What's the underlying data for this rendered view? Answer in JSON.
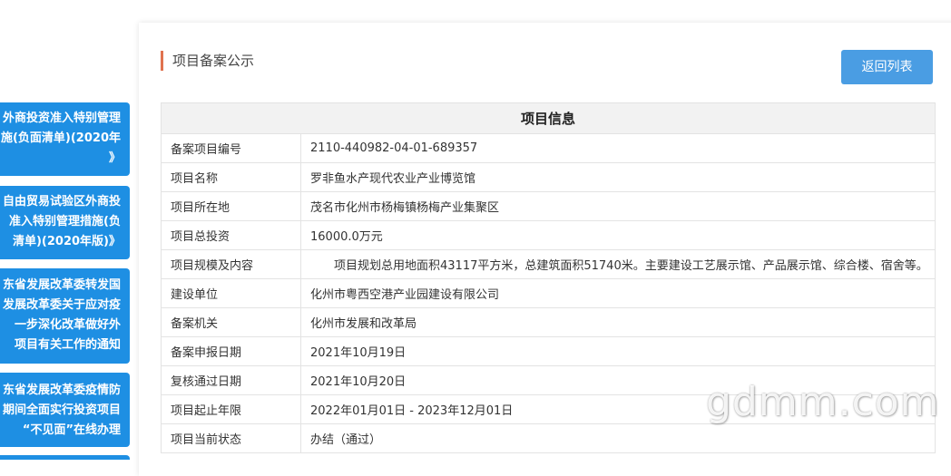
{
  "sidebar": {
    "cards": [
      {
        "lines": [
          "外商投资准入特别管理",
          "施(负面清单)(2020年",
          "》"
        ]
      },
      {
        "lines": [
          "自由贸易试验区外商投",
          "准入特别管理措施(负",
          "清单)(2020年版)》"
        ]
      },
      {
        "lines": [
          "东省发展改革委转发国",
          "发展改革委关于应对疫",
          "一步深化改革做好外",
          "项目有关工作的通知"
        ]
      },
      {
        "lines": [
          "东省发展改革委疫情防",
          "期间全面实行投资项目",
          "“不见面”在线办理"
        ]
      }
    ]
  },
  "panel": {
    "title": "项目备案公示",
    "back_label": "返回列表"
  },
  "table": {
    "header": "项目信息",
    "rows": [
      {
        "label": "备案项目编号",
        "value": "2110-440982-04-01-689357"
      },
      {
        "label": "项目名称",
        "value": "罗非鱼水产现代农业产业博览馆"
      },
      {
        "label": "项目所在地",
        "value": "茂名市化州市杨梅镇杨梅产业集聚区"
      },
      {
        "label": "项目总投资",
        "value": "16000.0万元"
      },
      {
        "label": "项目规模及内容",
        "value": "项目规划总用地面积43117平方米，总建筑面积51740米。主要建设工艺展示馆、产品展示馆、综合楼、宿舍等。"
      },
      {
        "label": "建设单位",
        "value": "化州市粤西空港产业园建设有限公司"
      },
      {
        "label": "备案机关",
        "value": "化州市发展和改革局"
      },
      {
        "label": "备案申报日期",
        "value": "2021年10月19日"
      },
      {
        "label": "复核通过日期",
        "value": "2021年10月20日"
      },
      {
        "label": "项目起止年限",
        "value": "2022年01月01日 - 2023年12月01日"
      },
      {
        "label": "项目当前状态",
        "value": "办结（通过）"
      }
    ]
  },
  "watermark": "gdmm.com"
}
